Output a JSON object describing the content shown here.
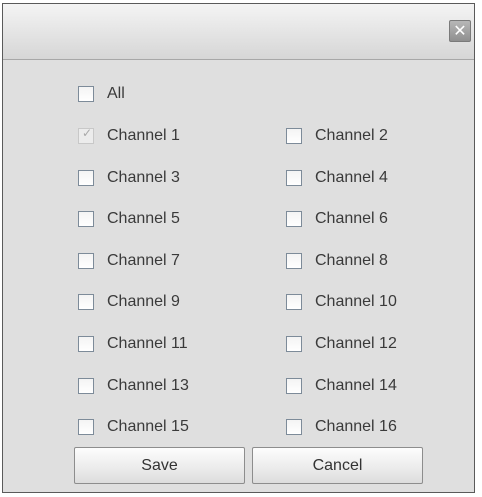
{
  "dialog": {
    "close_glyph": "✕"
  },
  "all_option": {
    "label": "All",
    "checked": false
  },
  "channels": [
    {
      "label": "Channel 1",
      "checked": true,
      "disabled": true
    },
    {
      "label": "Channel 2",
      "checked": false
    },
    {
      "label": "Channel 3",
      "checked": false
    },
    {
      "label": "Channel 4",
      "checked": false
    },
    {
      "label": "Channel 5",
      "checked": false
    },
    {
      "label": "Channel 6",
      "checked": false
    },
    {
      "label": "Channel 7",
      "checked": false
    },
    {
      "label": "Channel 8",
      "checked": false
    },
    {
      "label": "Channel 9",
      "checked": false
    },
    {
      "label": "Channel 10",
      "checked": false
    },
    {
      "label": "Channel 11",
      "checked": false
    },
    {
      "label": "Channel 12",
      "checked": false
    },
    {
      "label": "Channel 13",
      "checked": false
    },
    {
      "label": "Channel 14",
      "checked": false
    },
    {
      "label": "Channel 15",
      "checked": false
    },
    {
      "label": "Channel 16",
      "checked": false
    }
  ],
  "buttons": {
    "save_label": "Save",
    "cancel_label": "Cancel"
  },
  "icons": {
    "close": "close-icon",
    "checkmark": "checkmark-icon"
  },
  "colors": {
    "dialog_bg": "#dfdfdf",
    "checkbox_border": "#7d8b99",
    "text": "#3a3a3a"
  }
}
